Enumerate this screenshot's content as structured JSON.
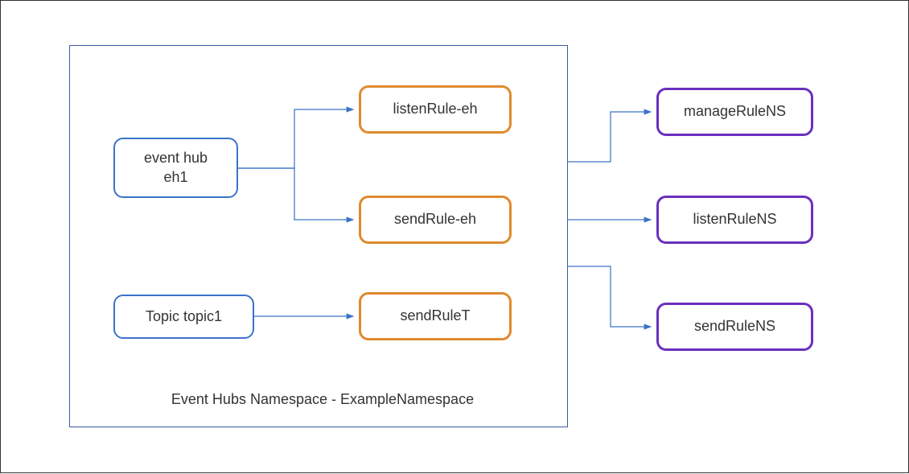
{
  "diagram": {
    "namespace_label": "Event Hubs Namespace - ExampleNamespace",
    "entities": {
      "eventhub": "event hub\neh1",
      "topic": "Topic topic1"
    },
    "hub_rules": {
      "listen": "listenRule-eh",
      "send": "sendRule-eh",
      "topic_send": "sendRuleT"
    },
    "ns_rules": {
      "manage": "manageRuleNS",
      "listen": "listenRuleNS",
      "send": "sendRuleNS"
    }
  }
}
